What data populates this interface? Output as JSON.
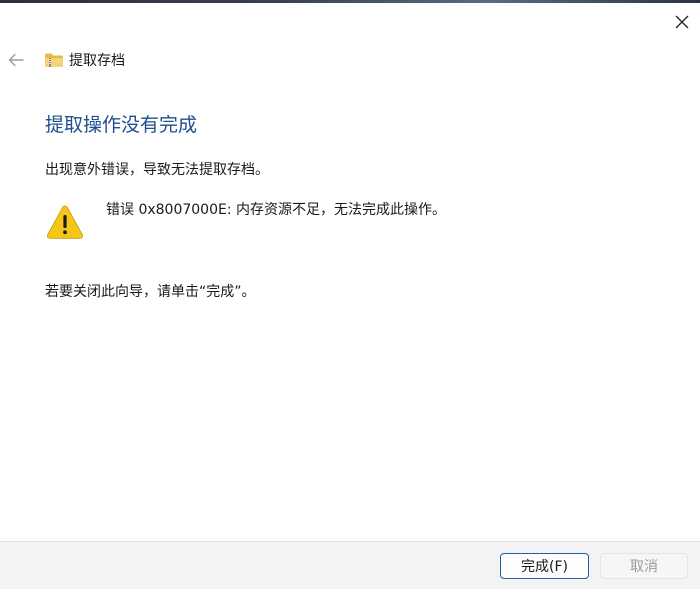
{
  "window": {
    "close_icon": "close-icon"
  },
  "header": {
    "back_icon": "arrow-left-icon",
    "folder_icon": "zip-folder-icon",
    "title": "提取存档"
  },
  "main": {
    "heading": "提取操作没有完成",
    "description": "出现意外错误，导致无法提取存档。",
    "error_icon": "warning-icon",
    "error_message": "错误 0x8007000E: 内存资源不足，无法完成此操作。",
    "close_hint": "若要关闭此向导，请单击“完成”。"
  },
  "footer": {
    "finish_label": "完成(F)",
    "cancel_label": "取消"
  },
  "colors": {
    "heading": "#1f4f8f",
    "primary_border": "#1c5fae",
    "warning_fill": "#f5c518",
    "disabled_text": "#9a9a9a"
  }
}
